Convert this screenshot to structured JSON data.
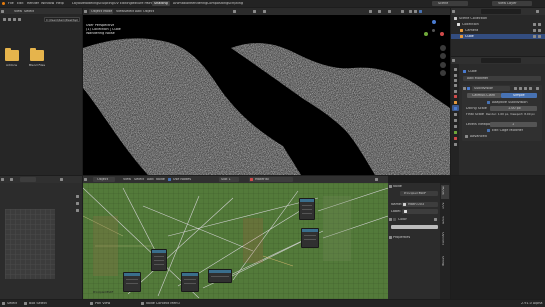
{
  "topbar": {
    "menus": [
      "File",
      "Edit",
      "Render",
      "Window",
      "Help"
    ],
    "workspaces": [
      "Layout",
      "Modeling",
      "Sculpting",
      "UV Editing",
      "Texture Paint",
      "Shading",
      "Animation",
      "Rendering",
      "Compositing",
      "Scripting"
    ],
    "active_workspace": "Shading",
    "scene": "Scene",
    "view_layer": "View Layer"
  },
  "file_browser": {
    "menus": [
      "View",
      "Select"
    ],
    "path": "C:\\Users\\Sam\\Desktop\\",
    "folders": [
      "Addons",
      "Blend Files"
    ]
  },
  "viewport": {
    "mode": "Object Mode",
    "menus": [
      "View",
      "Select",
      "Add",
      "Object"
    ],
    "overlay_lines": [
      "User Perspective",
      "(1) Collection | Cube",
      "Wandering Noise"
    ]
  },
  "outliner": {
    "title": "Scene Collection",
    "items": [
      "Collection",
      "Camera",
      "Cube"
    ]
  },
  "properties": {
    "object_name": "Cube",
    "add_modifier": "Add Modifier",
    "modifier_name": "Subdivision",
    "tabs": [
      "Catmull-Clark",
      "Simple"
    ],
    "adaptive": "Adaptive Subdivision",
    "fields": [
      {
        "label": "Dicing Scale",
        "value": "1.00 px"
      },
      {
        "label": "Final Scale",
        "value": "Render: 1.00 px, Viewport: 8.00 px"
      },
      {
        "label": "Levels Viewport",
        "value": "1"
      }
    ],
    "checkbox2": "Edit Cage Modifier",
    "section": "Advanced"
  },
  "node_editor": {
    "object": "Object",
    "menus": [
      "View",
      "Select",
      "Add",
      "Node"
    ],
    "use_nodes": "Use Nodes",
    "slot": "Slot 1",
    "material": "Material",
    "status_node_label": "Principled BSDF"
  },
  "sidebar_node": {
    "section": "Node",
    "name_label": "Name:",
    "name_value": "Math.003",
    "label_label": "Label:",
    "color": "Color",
    "properties": "Properties"
  },
  "side_tabs": [
    "Node",
    "Tool",
    "View",
    "Options",
    "Group"
  ],
  "statusbar": {
    "items": [
      "Select",
      "Box Select",
      "Pan View",
      "Node Context Menu"
    ],
    "version": "2.91.0 Alpha"
  }
}
